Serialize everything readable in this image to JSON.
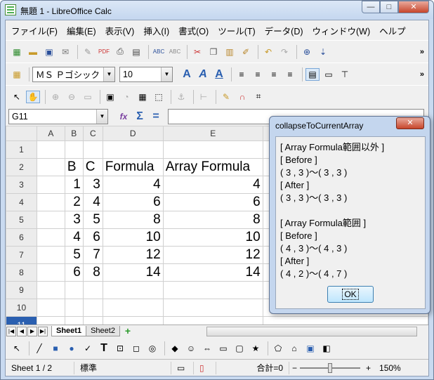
{
  "window": {
    "title": "無題 1 - LibreOffice Calc",
    "controls": {
      "minimize": "—",
      "maximize": "□",
      "close": "✕"
    }
  },
  "menu": [
    "ファイル(F)",
    "編集(E)",
    "表示(V)",
    "挿入(I)",
    "書式(O)",
    "ツール(T)",
    "データ(D)",
    "ウィンドウ(W)",
    "ヘルプ"
  ],
  "toolbar": {
    "font_name": "ＭＳ Ｐゴシック",
    "font_size": "10",
    "more": "»"
  },
  "formula_bar": {
    "name_box": "G11",
    "function_wizard": "fx",
    "sum": "Σ",
    "equals": "="
  },
  "sheet": {
    "column_headers": [
      "",
      "A",
      "B",
      "C",
      "D",
      "E"
    ],
    "rows": [
      {
        "n": "1",
        "cells": [
          "",
          "",
          "",
          "",
          ""
        ]
      },
      {
        "n": "2",
        "cells": [
          "",
          "B",
          "C",
          "Formula",
          "Array Formula"
        ]
      },
      {
        "n": "3",
        "cells": [
          "",
          "1",
          "3",
          "4",
          "4"
        ]
      },
      {
        "n": "4",
        "cells": [
          "",
          "2",
          "4",
          "6",
          "6"
        ]
      },
      {
        "n": "5",
        "cells": [
          "",
          "3",
          "5",
          "8",
          "8"
        ]
      },
      {
        "n": "6",
        "cells": [
          "",
          "4",
          "6",
          "10",
          "10"
        ]
      },
      {
        "n": "7",
        "cells": [
          "",
          "5",
          "7",
          "12",
          "12"
        ]
      },
      {
        "n": "8",
        "cells": [
          "",
          "6",
          "8",
          "14",
          "14"
        ]
      },
      {
        "n": "9",
        "cells": [
          "",
          "",
          "",
          "",
          ""
        ]
      },
      {
        "n": "10",
        "cells": [
          "",
          "",
          "",
          "",
          ""
        ]
      },
      {
        "n": "11",
        "cells": [
          "",
          "",
          "",
          "",
          ""
        ]
      }
    ]
  },
  "tabs": {
    "items": [
      "Sheet1",
      "Sheet2"
    ],
    "active": "Sheet1",
    "add": "+"
  },
  "status": {
    "sheet": "Sheet 1 / 2",
    "style": "標準",
    "sum": "合計=0",
    "zoom_minus": "−",
    "zoom_plus": "+",
    "zoom": "150%"
  },
  "dialog": {
    "title": "collapseToCurrentArray",
    "close": "✕",
    "lines": [
      "[ Array Formula範囲以外 ]",
      "[ Before ]",
      "( 3 , 3 )～( 3 , 3 )",
      "[ After ]",
      "( 3 , 3 )～( 3 , 3 )",
      "",
      "[ Array Formula範囲 ]",
      "[ Before ]",
      "( 4 , 3 )～( 4 , 3 )",
      "[ After ]",
      "( 4 , 2 )～( 4 , 7 )"
    ],
    "ok": "OK"
  }
}
